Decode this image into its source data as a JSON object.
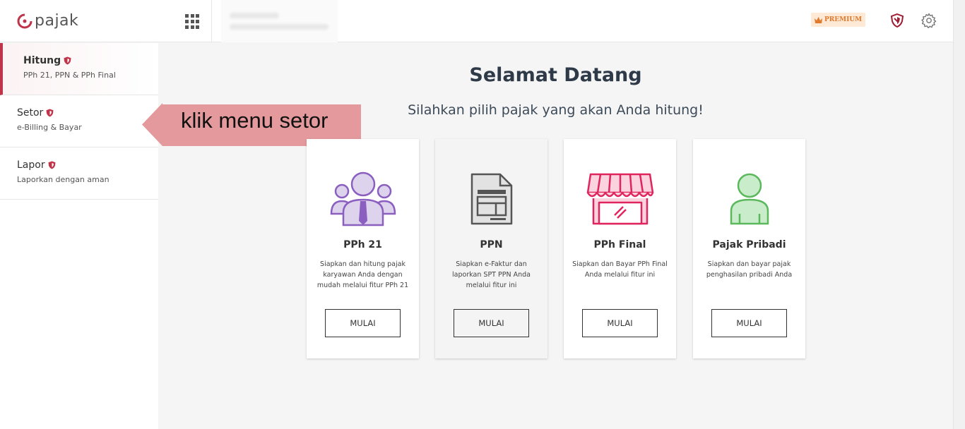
{
  "header": {
    "logo_text": "pajak",
    "premium_label": "PREMIUM",
    "apps_icon": "apps-grid-icon",
    "shield_icon": "shield-icon",
    "settings_icon": "gear-icon"
  },
  "sidebar": {
    "items": [
      {
        "title": "Hitung",
        "subtitle": "PPh 21, PPN & PPh Final",
        "active": true
      },
      {
        "title": "Setor",
        "subtitle": "e-Billing & Bayar",
        "active": false
      },
      {
        "title": "Lapor",
        "subtitle": "Laporkan dengan aman",
        "active": false
      }
    ]
  },
  "annotation": {
    "text": "klik menu setor"
  },
  "main": {
    "title": "Selamat Datang",
    "subtitle": "Silahkan pilih pajak yang akan Anda hitung!",
    "cards": [
      {
        "title": "PPh 21",
        "desc": "Siapkan dan hitung pajak karyawan Anda dengan mudah melalui fitur PPh 21",
        "button": "MULAI",
        "icon": "group-people-icon"
      },
      {
        "title": "PPN",
        "desc": "Siapkan e-Faktur dan laporkan SPT PPN Anda melalui fitur ini",
        "button": "MULAI",
        "icon": "document-icon"
      },
      {
        "title": "PPh Final",
        "desc": "Siapkan dan Bayar PPh Final Anda melalui fitur ini",
        "button": "MULAI",
        "icon": "store-icon"
      },
      {
        "title": "Pajak Pribadi",
        "desc": "Siapkan dan bayar pajak penghasilan pribadi Anda",
        "button": "MULAI",
        "icon": "person-icon"
      }
    ]
  },
  "colors": {
    "brand": "#c0344a",
    "pph21": "#8b5fbf",
    "ppn": "#555555",
    "pph_final": "#e0245e",
    "pribadi": "#5cb85c",
    "premium": "#e07a2d"
  }
}
